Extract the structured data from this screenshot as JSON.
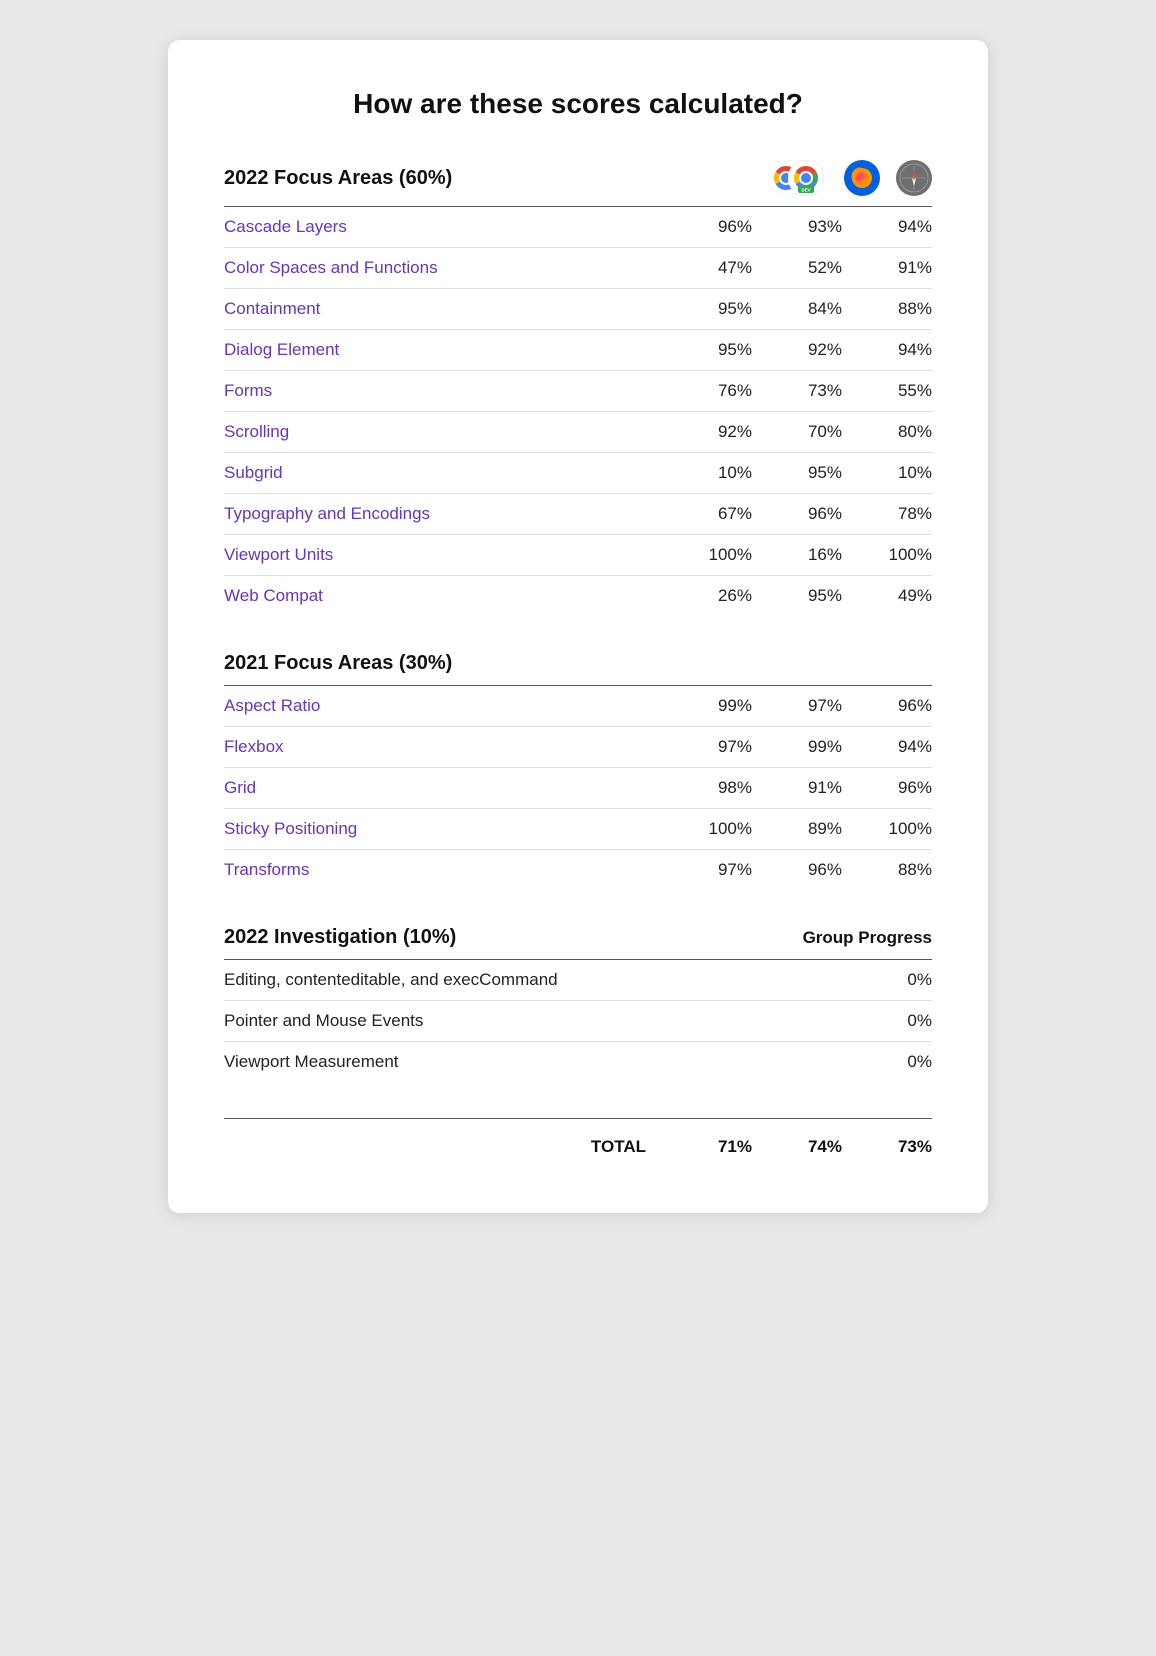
{
  "title": "How are these scores calculated?",
  "section2022": {
    "label": "2022 Focus Areas (60%)",
    "rows": [
      {
        "name": "Cascade Layers",
        "v1": "96%",
        "v2": "93%",
        "v3": "94%"
      },
      {
        "name": "Color Spaces and Functions",
        "v1": "47%",
        "v2": "52%",
        "v3": "91%"
      },
      {
        "name": "Containment",
        "v1": "95%",
        "v2": "84%",
        "v3": "88%"
      },
      {
        "name": "Dialog Element",
        "v1": "95%",
        "v2": "92%",
        "v3": "94%"
      },
      {
        "name": "Forms",
        "v1": "76%",
        "v2": "73%",
        "v3": "55%"
      },
      {
        "name": "Scrolling",
        "v1": "92%",
        "v2": "70%",
        "v3": "80%"
      },
      {
        "name": "Subgrid",
        "v1": "10%",
        "v2": "95%",
        "v3": "10%"
      },
      {
        "name": "Typography and Encodings",
        "v1": "67%",
        "v2": "96%",
        "v3": "78%"
      },
      {
        "name": "Viewport Units",
        "v1": "100%",
        "v2": "16%",
        "v3": "100%"
      },
      {
        "name": "Web Compat",
        "v1": "26%",
        "v2": "95%",
        "v3": "49%"
      }
    ]
  },
  "section2021": {
    "label": "2021 Focus Areas (30%)",
    "rows": [
      {
        "name": "Aspect Ratio",
        "v1": "99%",
        "v2": "97%",
        "v3": "96%"
      },
      {
        "name": "Flexbox",
        "v1": "97%",
        "v2": "99%",
        "v3": "94%"
      },
      {
        "name": "Grid",
        "v1": "98%",
        "v2": "91%",
        "v3": "96%"
      },
      {
        "name": "Sticky Positioning",
        "v1": "100%",
        "v2": "89%",
        "v3": "100%"
      },
      {
        "name": "Transforms",
        "v1": "97%",
        "v2": "96%",
        "v3": "88%"
      }
    ]
  },
  "sectionInvestigation": {
    "label": "2022 Investigation (10%)",
    "group_progress_label": "Group Progress",
    "rows": [
      {
        "name": "Editing, contenteditable, and execCommand",
        "val": "0%"
      },
      {
        "name": "Pointer and Mouse Events",
        "val": "0%"
      },
      {
        "name": "Viewport Measurement",
        "val": "0%"
      }
    ]
  },
  "total": {
    "label": "TOTAL",
    "v1": "71%",
    "v2": "74%",
    "v3": "73%"
  }
}
